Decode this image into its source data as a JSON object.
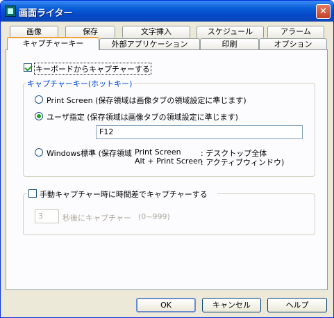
{
  "window": {
    "title": "画面ライター"
  },
  "tabs_row1": [
    "画像",
    "保存",
    "文字挿入",
    "スケジュール",
    "アラーム"
  ],
  "tabs_row2": [
    "キャプチャーキー",
    "外部アプリケーション",
    "印刷",
    "オプション"
  ],
  "capture_with_keyboard": {
    "label": "キーボードからキャプチャーする",
    "checked": true
  },
  "capture_key_group": {
    "title": "キャプチャーキー(ホットキー)",
    "option_printscreen": "Print Screen (保存領域は画像タブの領域設定に準じます)",
    "option_user": "ユーザ指定 (保存領域は画像タブの領域設定に準じます)",
    "user_key_value": "F12",
    "option_windows": "Windows標準 (保存領域",
    "windows_line1_key": "Print Screen",
    "windows_line1_desc": ": デスクトップ全体",
    "windows_line2_key": "Alt + Print Screen",
    "windows_line2_desc": ": アクティブウィンドウ)",
    "selected": "user"
  },
  "delay_group": {
    "title": "手動キャプチャー時に時間差でキャプチャーする",
    "checked": false,
    "seconds_value": "3",
    "suffix": "秒後にキャプチャー",
    "range": "(0~999)"
  },
  "buttons": {
    "ok": "OK",
    "cancel": "キャンセル",
    "help": "ヘルプ"
  }
}
